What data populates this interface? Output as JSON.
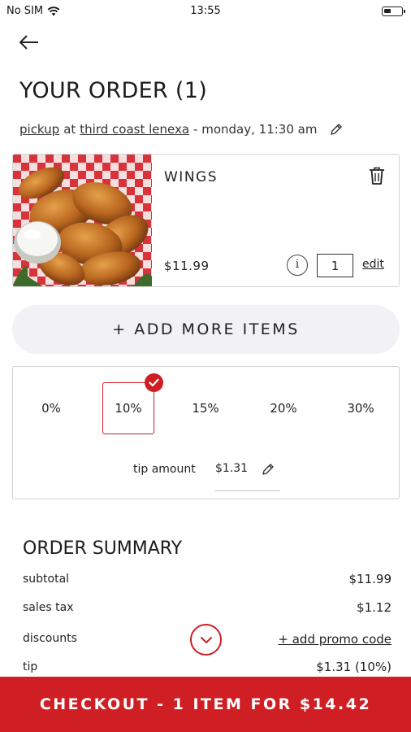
{
  "status_bar": {
    "carrier": "No SIM",
    "time": "13:55",
    "battery_level": 0.4
  },
  "header": {
    "title": "YOUR ORDER (1)"
  },
  "order_meta": {
    "method": "pickup",
    "at": "at",
    "location": "third coast lenexa",
    "time": "- monday, 11:30 am"
  },
  "item": {
    "name": "WINGS",
    "price": "$11.99",
    "info_label": "i",
    "quantity": "1",
    "edit_label": "edit"
  },
  "add_more_label": "+ ADD MORE ITEMS",
  "tip": {
    "options": [
      "0%",
      "10%",
      "15%",
      "20%",
      "30%"
    ],
    "selected": "10%",
    "amount_label": "tip amount",
    "amount_value": "$1.31"
  },
  "summary": {
    "title": "ORDER SUMMARY",
    "subtotal_label": "subtotal",
    "subtotal_value": "$11.99",
    "tax_label": "sales tax",
    "tax_value": "$1.12",
    "discounts_label": "discounts",
    "promo_label": "+ add promo code",
    "tip_label": "tip",
    "tip_value": "$1.31 (10%)"
  },
  "checkout_label": "CHECKOUT - 1 ITEM FOR $14.42",
  "colors": {
    "accent": "#cf1f24",
    "pill_bg": "#f2f2f6"
  }
}
